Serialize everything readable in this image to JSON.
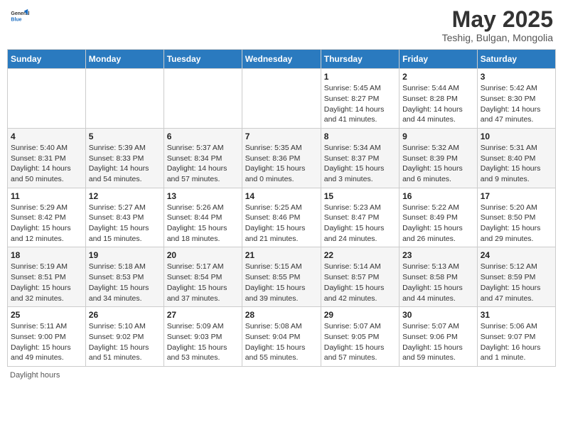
{
  "header": {
    "logo": {
      "general": "General",
      "blue": "Blue"
    },
    "title": "May 2025",
    "subtitle": "Teshig, Bulgan, Mongolia"
  },
  "days_of_week": [
    "Sunday",
    "Monday",
    "Tuesday",
    "Wednesday",
    "Thursday",
    "Friday",
    "Saturday"
  ],
  "footer": {
    "daylight_label": "Daylight hours"
  },
  "weeks": [
    [
      {
        "day": "",
        "info": ""
      },
      {
        "day": "",
        "info": ""
      },
      {
        "day": "",
        "info": ""
      },
      {
        "day": "",
        "info": ""
      },
      {
        "day": "1",
        "info": "Sunrise: 5:45 AM\nSunset: 8:27 PM\nDaylight: 14 hours and 41 minutes."
      },
      {
        "day": "2",
        "info": "Sunrise: 5:44 AM\nSunset: 8:28 PM\nDaylight: 14 hours and 44 minutes."
      },
      {
        "day": "3",
        "info": "Sunrise: 5:42 AM\nSunset: 8:30 PM\nDaylight: 14 hours and 47 minutes."
      }
    ],
    [
      {
        "day": "4",
        "info": "Sunrise: 5:40 AM\nSunset: 8:31 PM\nDaylight: 14 hours and 50 minutes."
      },
      {
        "day": "5",
        "info": "Sunrise: 5:39 AM\nSunset: 8:33 PM\nDaylight: 14 hours and 54 minutes."
      },
      {
        "day": "6",
        "info": "Sunrise: 5:37 AM\nSunset: 8:34 PM\nDaylight: 14 hours and 57 minutes."
      },
      {
        "day": "7",
        "info": "Sunrise: 5:35 AM\nSunset: 8:36 PM\nDaylight: 15 hours and 0 minutes."
      },
      {
        "day": "8",
        "info": "Sunrise: 5:34 AM\nSunset: 8:37 PM\nDaylight: 15 hours and 3 minutes."
      },
      {
        "day": "9",
        "info": "Sunrise: 5:32 AM\nSunset: 8:39 PM\nDaylight: 15 hours and 6 minutes."
      },
      {
        "day": "10",
        "info": "Sunrise: 5:31 AM\nSunset: 8:40 PM\nDaylight: 15 hours and 9 minutes."
      }
    ],
    [
      {
        "day": "11",
        "info": "Sunrise: 5:29 AM\nSunset: 8:42 PM\nDaylight: 15 hours and 12 minutes."
      },
      {
        "day": "12",
        "info": "Sunrise: 5:27 AM\nSunset: 8:43 PM\nDaylight: 15 hours and 15 minutes."
      },
      {
        "day": "13",
        "info": "Sunrise: 5:26 AM\nSunset: 8:44 PM\nDaylight: 15 hours and 18 minutes."
      },
      {
        "day": "14",
        "info": "Sunrise: 5:25 AM\nSunset: 8:46 PM\nDaylight: 15 hours and 21 minutes."
      },
      {
        "day": "15",
        "info": "Sunrise: 5:23 AM\nSunset: 8:47 PM\nDaylight: 15 hours and 24 minutes."
      },
      {
        "day": "16",
        "info": "Sunrise: 5:22 AM\nSunset: 8:49 PM\nDaylight: 15 hours and 26 minutes."
      },
      {
        "day": "17",
        "info": "Sunrise: 5:20 AM\nSunset: 8:50 PM\nDaylight: 15 hours and 29 minutes."
      }
    ],
    [
      {
        "day": "18",
        "info": "Sunrise: 5:19 AM\nSunset: 8:51 PM\nDaylight: 15 hours and 32 minutes."
      },
      {
        "day": "19",
        "info": "Sunrise: 5:18 AM\nSunset: 8:53 PM\nDaylight: 15 hours and 34 minutes."
      },
      {
        "day": "20",
        "info": "Sunrise: 5:17 AM\nSunset: 8:54 PM\nDaylight: 15 hours and 37 minutes."
      },
      {
        "day": "21",
        "info": "Sunrise: 5:15 AM\nSunset: 8:55 PM\nDaylight: 15 hours and 39 minutes."
      },
      {
        "day": "22",
        "info": "Sunrise: 5:14 AM\nSunset: 8:57 PM\nDaylight: 15 hours and 42 minutes."
      },
      {
        "day": "23",
        "info": "Sunrise: 5:13 AM\nSunset: 8:58 PM\nDaylight: 15 hours and 44 minutes."
      },
      {
        "day": "24",
        "info": "Sunrise: 5:12 AM\nSunset: 8:59 PM\nDaylight: 15 hours and 47 minutes."
      }
    ],
    [
      {
        "day": "25",
        "info": "Sunrise: 5:11 AM\nSunset: 9:00 PM\nDaylight: 15 hours and 49 minutes."
      },
      {
        "day": "26",
        "info": "Sunrise: 5:10 AM\nSunset: 9:02 PM\nDaylight: 15 hours and 51 minutes."
      },
      {
        "day": "27",
        "info": "Sunrise: 5:09 AM\nSunset: 9:03 PM\nDaylight: 15 hours and 53 minutes."
      },
      {
        "day": "28",
        "info": "Sunrise: 5:08 AM\nSunset: 9:04 PM\nDaylight: 15 hours and 55 minutes."
      },
      {
        "day": "29",
        "info": "Sunrise: 5:07 AM\nSunset: 9:05 PM\nDaylight: 15 hours and 57 minutes."
      },
      {
        "day": "30",
        "info": "Sunrise: 5:07 AM\nSunset: 9:06 PM\nDaylight: 15 hours and 59 minutes."
      },
      {
        "day": "31",
        "info": "Sunrise: 5:06 AM\nSunset: 9:07 PM\nDaylight: 16 hours and 1 minute."
      }
    ]
  ]
}
